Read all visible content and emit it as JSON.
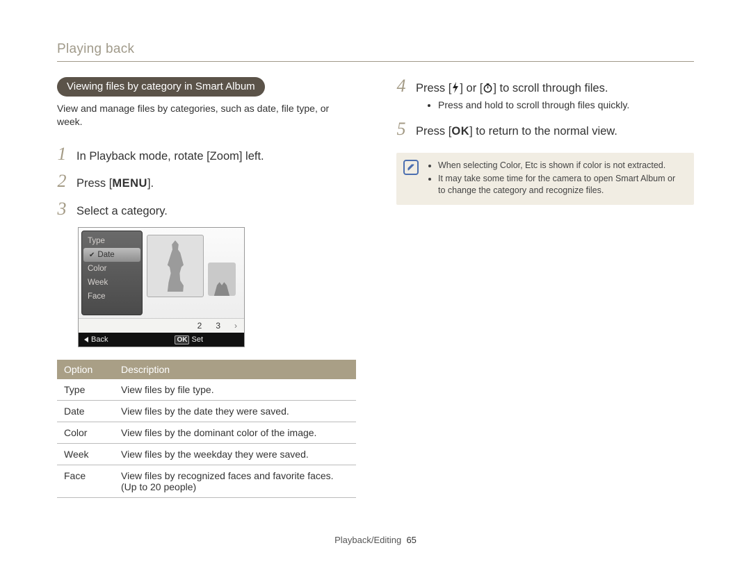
{
  "header": {
    "title": "Playing back"
  },
  "left": {
    "section_pill": "Viewing files by category in Smart Album",
    "intro": "View and manage files by categories, such as date, file type, or week.",
    "steps": {
      "1": "In Playback mode, rotate [Zoom] left.",
      "2_pre": "Press [",
      "2_key": "MENU",
      "2_post": "].",
      "3": "Select a category."
    },
    "screenshot": {
      "menu": [
        "Type",
        "Date",
        "Color",
        "Week",
        "Face"
      ],
      "selected_index": 1,
      "pager": [
        "2",
        "3",
        "›"
      ],
      "back_label": "Back",
      "set_label": "Set"
    },
    "table": {
      "headers": [
        "Option",
        "Description"
      ],
      "rows": [
        [
          "Type",
          "View files by file type."
        ],
        [
          "Date",
          "View files by the date they were saved."
        ],
        [
          "Color",
          "View files by the dominant color of the image."
        ],
        [
          "Week",
          "View files by the weekday they were saved."
        ],
        [
          "Face",
          "View files by recognized faces and favorite faces. (Up to 20 people)"
        ]
      ]
    }
  },
  "right": {
    "steps": {
      "4_pre": "Press [",
      "4_mid": "] or [",
      "4_post": "] to scroll through files.",
      "4_sub": "Press and hold to scroll through files quickly.",
      "5_pre": "Press [",
      "5_key": "OK",
      "5_post": "] to return to the normal view."
    },
    "note": {
      "items": [
        "When selecting Color, Etc is shown if color is not extracted.",
        "It may take some time for the camera to open Smart Album or to change the category and recognize files."
      ]
    }
  },
  "footer": {
    "section": "Playback/Editing",
    "page": "65"
  }
}
